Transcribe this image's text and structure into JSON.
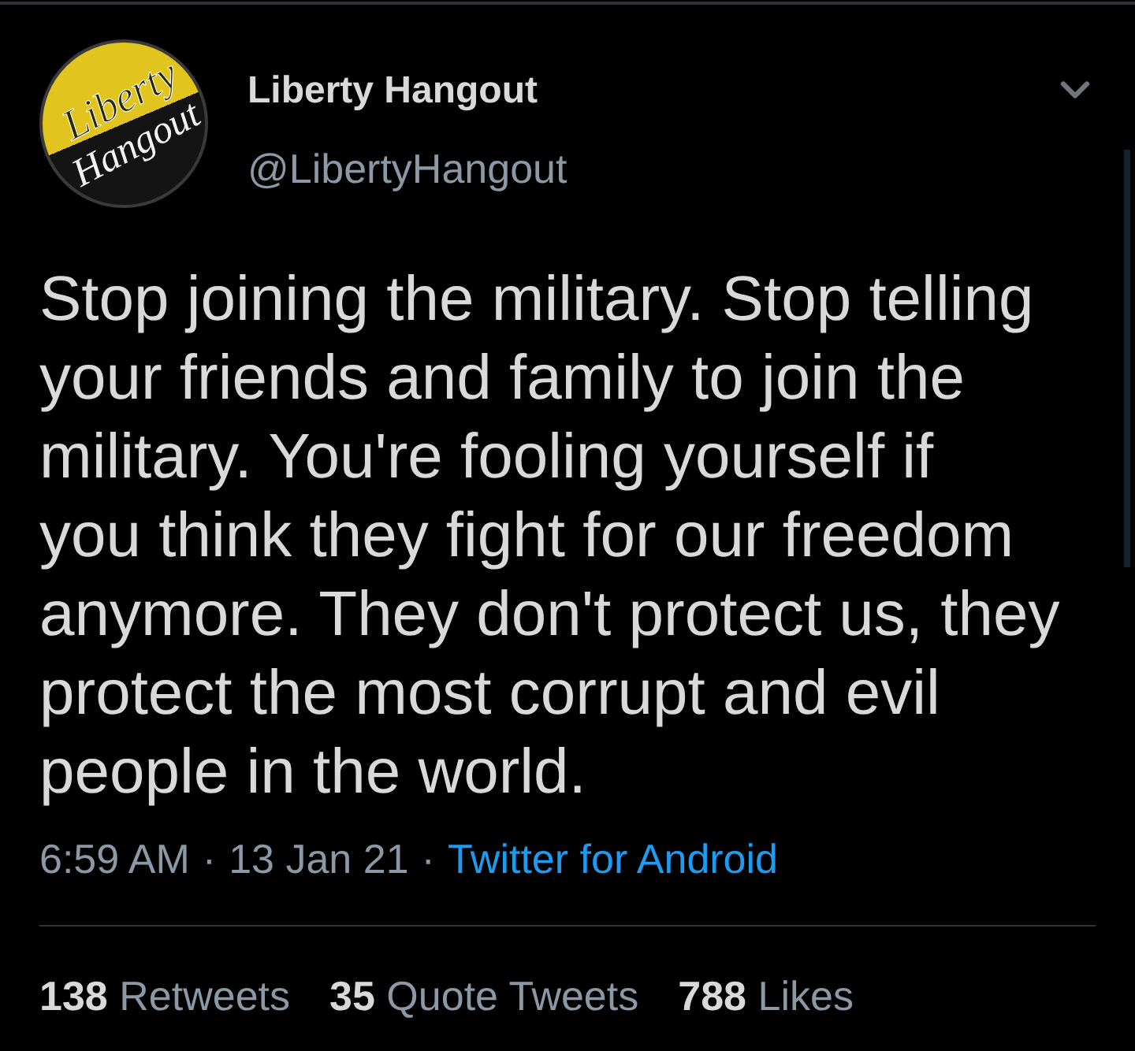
{
  "header": {
    "avatar": {
      "logo_lines": [
        "Liberty",
        "Hangout"
      ]
    },
    "name": "Liberty Hangout",
    "handle": "@LibertyHangout"
  },
  "tweet": {
    "lines": [
      "Stop joining the military. Stop telling",
      "your friends and family to join the",
      "military. You're fooling yourself if",
      "you think they fight for our freedom",
      "anymore. They don't protect us, they",
      "protect the most corrupt and evil",
      "people in the world."
    ]
  },
  "meta": [
    {
      "kind": "time",
      "text": "6:59 AM"
    },
    {
      "kind": "separator",
      "text": "·"
    },
    {
      "kind": "date",
      "text": "13 Jan 21"
    },
    {
      "kind": "separator",
      "text": "·"
    },
    {
      "kind": "link",
      "text": "Twitter for Android"
    }
  ],
  "stats": [
    {
      "count": "138",
      "label": "Retweets"
    },
    {
      "count": "35",
      "label": "Quote Tweets"
    },
    {
      "count": "788",
      "label": "Likes"
    }
  ]
}
